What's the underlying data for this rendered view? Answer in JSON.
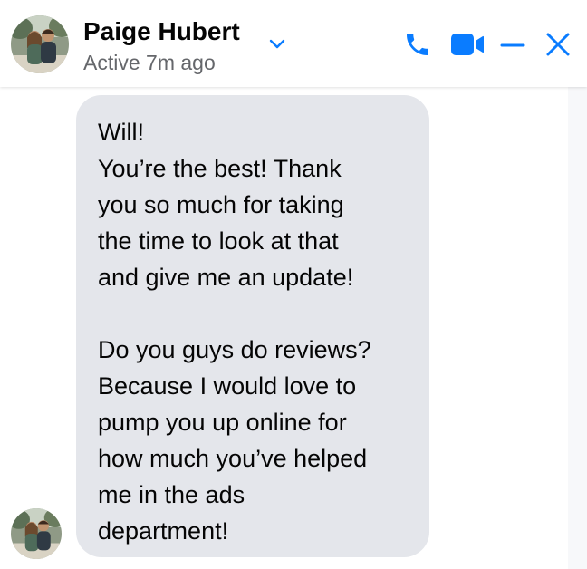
{
  "header": {
    "contact_name": "Paige Hubert",
    "status": "Active 7m ago",
    "avatar_icon": "profile-photo-couple",
    "actions": {
      "call_icon": "phone-icon",
      "video_icon": "video-camera-icon",
      "minimize_icon": "minimize-icon",
      "close_icon": "close-icon"
    }
  },
  "conversation": {
    "messages": [
      {
        "sender": "Paige Hubert",
        "paragraphs": [
          "Will!\nYou’re the best! Thank\nyou so much for taking\nthe time to look at that\nand give me an update!",
          "Do you guys do reviews?\nBecause I would love to\npump you up online for\nhow much you’ve helped\nme in the ads\ndepartment!"
        ]
      }
    ]
  },
  "colors": {
    "accent": "#0a7cff",
    "bubble_background": "#e4e6eb",
    "text_primary": "#050505",
    "text_secondary": "#65676b"
  }
}
